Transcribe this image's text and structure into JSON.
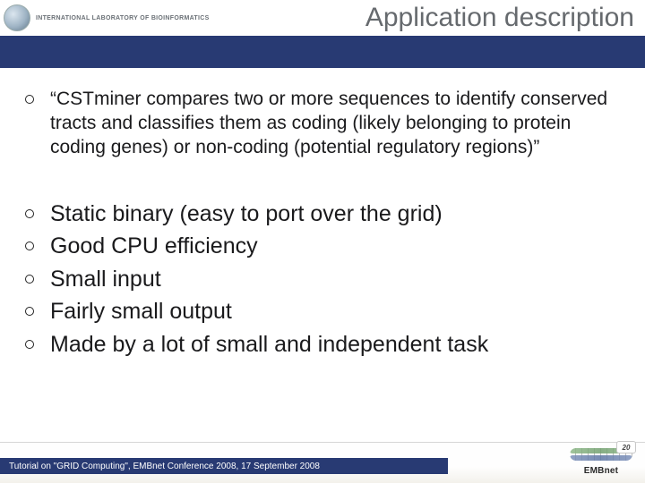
{
  "header": {
    "logo_label": "INTERNATIONAL LABORATORY OF BIOINFORMATICS",
    "title": "Application description"
  },
  "bullets": {
    "main_quote": "“CSTminer compares two or more sequences to identify conserved tracts and classifies them as coding (likely belonging to protein coding genes) or non-coding (potential regulatory regions)”",
    "items": [
      "Static binary (easy to port over the grid)",
      "Good CPU efficiency",
      "Small input",
      "Fairly small output",
      "Made by a lot of small and independent task"
    ]
  },
  "footer": {
    "text": "Tutorial on \"GRID Computing\", EMBnet Conference 2008, 17 September 2008",
    "badge": "20",
    "org": "EMBnet"
  }
}
